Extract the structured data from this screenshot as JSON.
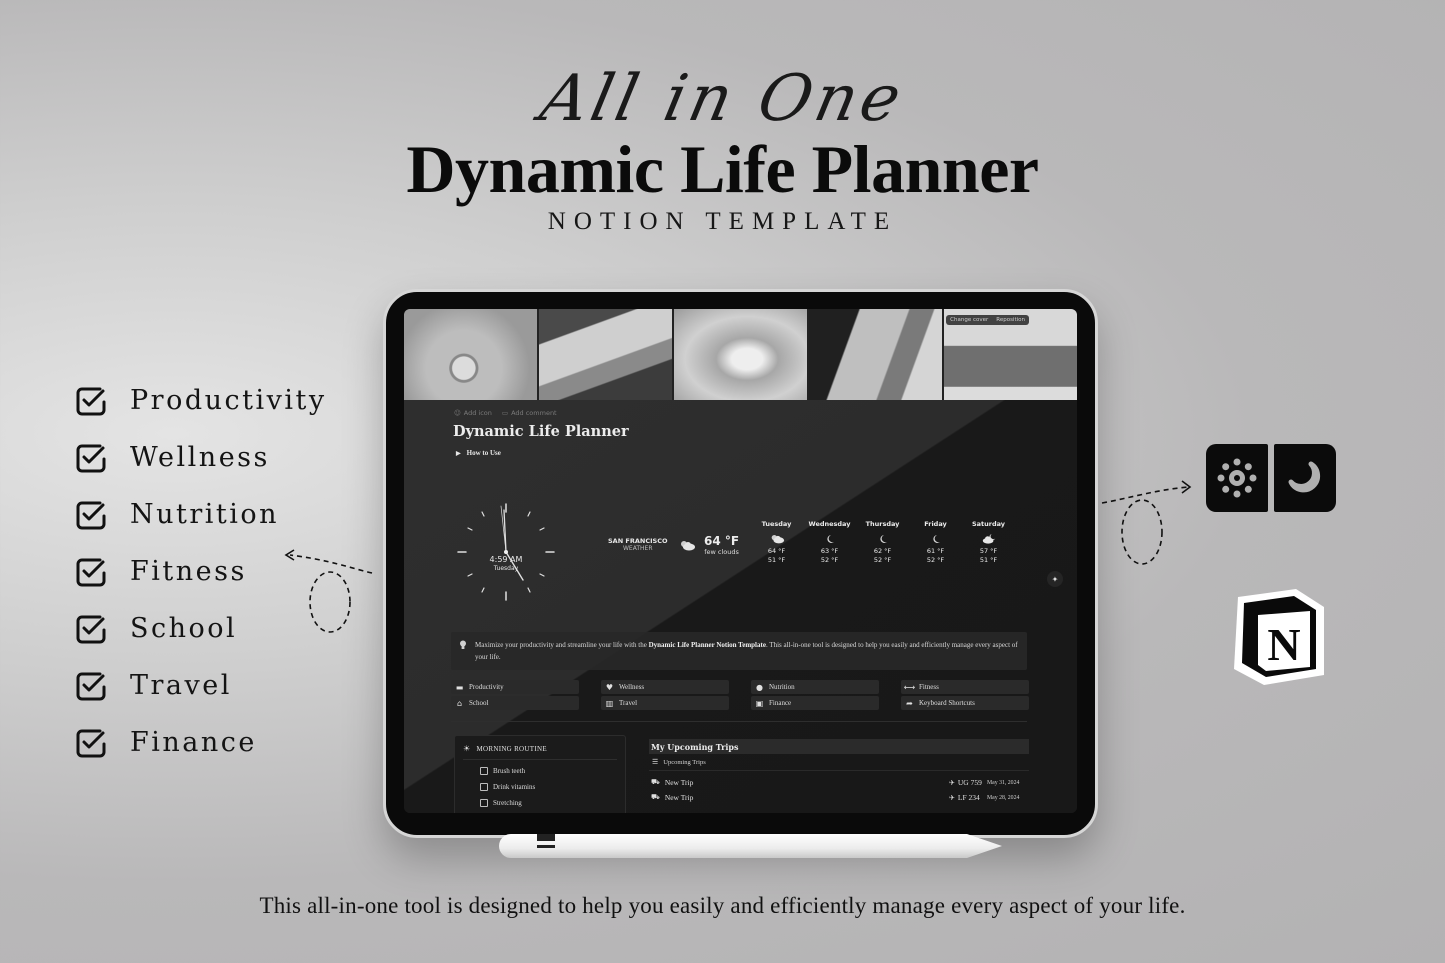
{
  "hero": {
    "script_title": "All in One",
    "main_title": "Dynamic Life Planner",
    "subtitle": "NOTION TEMPLATE",
    "tagline": "This all-in-one tool is designed to help you easily and efficiently manage every aspect of your life."
  },
  "features": [
    {
      "label": "Productivity",
      "icon": "checkbox-checked-icon"
    },
    {
      "label": "Wellness",
      "icon": "checkbox-checked-icon"
    },
    {
      "label": "Nutrition",
      "icon": "checkbox-checked-icon"
    },
    {
      "label": "Fitness",
      "icon": "checkbox-checked-icon"
    },
    {
      "label": "School",
      "icon": "checkbox-checked-icon"
    },
    {
      "label": "Travel",
      "icon": "checkbox-checked-icon"
    },
    {
      "label": "Finance",
      "icon": "checkbox-checked-icon"
    }
  ],
  "mode_toggle": {
    "light_icon": "sun-icon",
    "dark_icon": "moon-icon"
  },
  "brand_icon": "notion-logo-icon",
  "notion_page": {
    "cover_buttons": {
      "change_cover": "Change cover",
      "reposition": "Reposition"
    },
    "meta": {
      "add_icon": "Add icon",
      "add_comment": "Add comment"
    },
    "title": "Dynamic Life Planner",
    "toggle_label": "How to Use",
    "clock": {
      "time": "4:59 AM",
      "day": "Tuesday"
    },
    "weather": {
      "city": "SAN FRANCISCO",
      "label": "WEATHER",
      "current_temp": "64 °F",
      "current_desc": "few clouds",
      "current_icon": "partly-cloudy-icon",
      "forecast": [
        {
          "day": "Tuesday",
          "icon": "partly-cloudy-icon",
          "high": "64 °F",
          "low": "51 °F"
        },
        {
          "day": "Wednesday",
          "icon": "moon-icon",
          "high": "63 °F",
          "low": "52 °F"
        },
        {
          "day": "Thursday",
          "icon": "moon-icon",
          "high": "62 °F",
          "low": "52 °F"
        },
        {
          "day": "Friday",
          "icon": "moon-icon",
          "high": "61 °F",
          "low": "52 °F"
        },
        {
          "day": "Saturday",
          "icon": "cloudy-moon-icon",
          "high": "57 °F",
          "low": "51 °F"
        }
      ]
    },
    "callout": {
      "text_before": "Maximize your productivity and streamline your life with the ",
      "text_bold": "Dynamic Life Planner Notion Template",
      "text_after": ". This all-in-one tool is designed to help you easily and efficiently manage every aspect of your life."
    },
    "nav": [
      {
        "label": "Productivity",
        "glyph": "▬"
      },
      {
        "label": "Wellness",
        "glyph": "♥"
      },
      {
        "label": "Nutrition",
        "glyph": "●"
      },
      {
        "label": "Fitness",
        "glyph": "⟷"
      },
      {
        "label": "School",
        "glyph": "⌂"
      },
      {
        "label": "Travel",
        "glyph": "▥"
      },
      {
        "label": "Finance",
        "glyph": "▣"
      },
      {
        "label": "Keyboard Shortcuts",
        "glyph": "➦"
      }
    ],
    "routine": {
      "title": "MORNING ROUTINE",
      "items": [
        "Brush teeth",
        "Drink vitamins",
        "Stretching"
      ]
    },
    "trips": {
      "title": "My Upcoming Trips",
      "view_label": "Upcoming Trips",
      "rows": [
        {
          "name": "New Trip",
          "flight": "UG 759",
          "date": "May 31, 2024"
        },
        {
          "name": "New Trip",
          "flight": "LF 234",
          "date": "May 28, 2024"
        }
      ]
    }
  }
}
